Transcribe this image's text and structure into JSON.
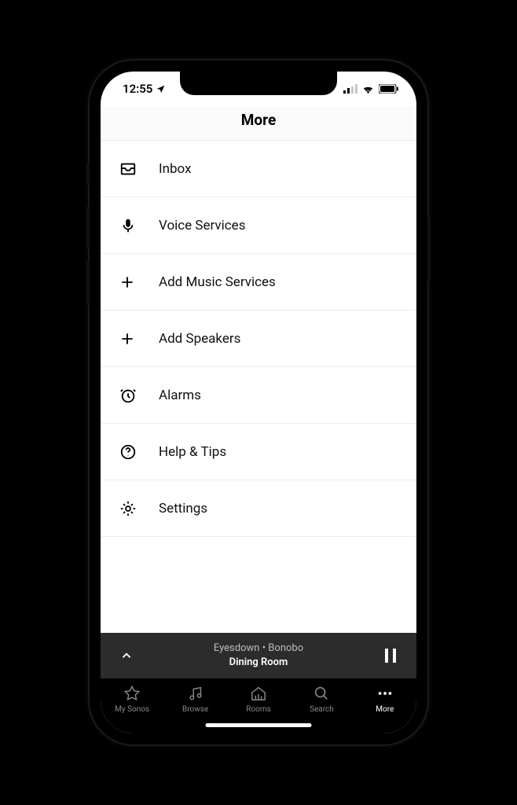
{
  "status": {
    "time": "12:55"
  },
  "header": {
    "title": "More"
  },
  "menu": [
    {
      "label": "Inbox"
    },
    {
      "label": "Voice Services"
    },
    {
      "label": "Add Music Services"
    },
    {
      "label": "Add Speakers"
    },
    {
      "label": "Alarms"
    },
    {
      "label": "Help & Tips"
    },
    {
      "label": "Settings"
    }
  ],
  "now_playing": {
    "track_artist": "Eyesdown • Bonobo",
    "room": "Dining Room"
  },
  "tabs": [
    {
      "label": "My Sonos"
    },
    {
      "label": "Browse"
    },
    {
      "label": "Rooms"
    },
    {
      "label": "Search"
    },
    {
      "label": "More"
    }
  ]
}
